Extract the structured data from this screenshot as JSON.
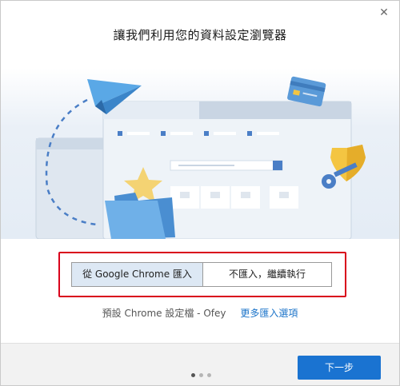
{
  "dialog": {
    "title": "讓我們利用您的資料設定瀏覽器",
    "close_glyph": "✕"
  },
  "import": {
    "from_chrome_label": "從 Google Chrome 匯入",
    "skip_label": "不匯入，繼續執行"
  },
  "profile": {
    "text": "預設 Chrome 設定檔 - Ofey",
    "more_options": "更多匯入選項"
  },
  "footer": {
    "next_label": "下一步",
    "pager": {
      "total": 3,
      "current": 1
    }
  },
  "colors": {
    "accent": "#1a73d1",
    "highlight_border": "#d9001b",
    "selected_segment": "#dde8f4"
  },
  "illustration": {
    "icons": [
      "paper-plane-icon",
      "credit-card-icon",
      "shield-icon",
      "key-icon",
      "star-icon",
      "folder-icon",
      "browser-window-icon"
    ]
  }
}
